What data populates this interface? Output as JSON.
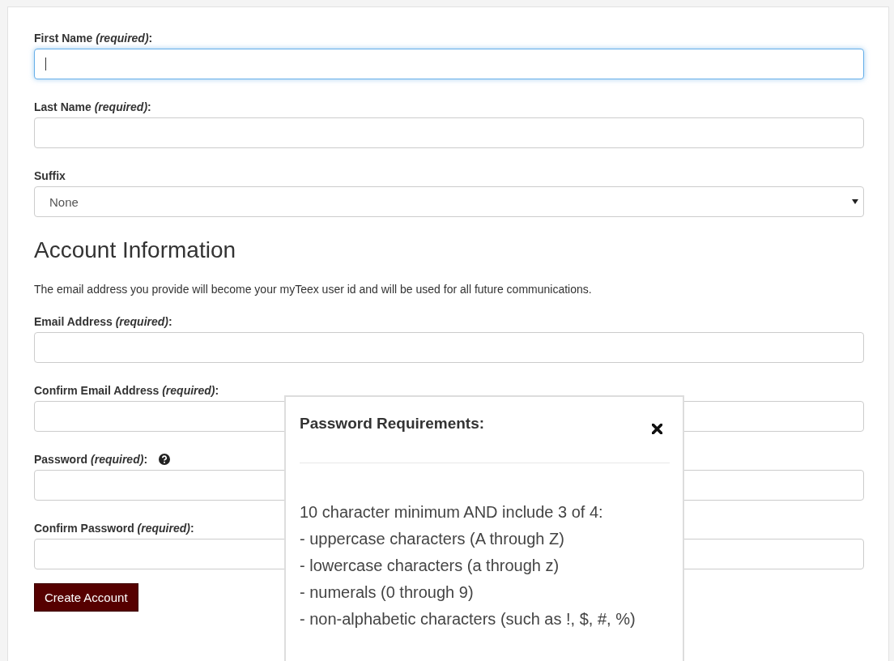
{
  "name_fields": [
    {
      "kind": "text",
      "label": "First Name *(required)*:",
      "focused": true
    },
    {
      "kind": "text",
      "label": "Last Name *(required)*:",
      "focused": false
    },
    {
      "kind": "select",
      "label": "Suffix",
      "value": "None",
      "focused": false
    }
  ],
  "account_section": {
    "title": "Account Information",
    "intro": "The email address you provide will become your myTeex user id and will be used for all future communications.",
    "fields": [
      {
        "kind": "text",
        "label": "Email Address *(required)*:",
        "focused": false
      },
      {
        "kind": "text",
        "label": "Confirm Email Address *(required)*:",
        "focused": false
      },
      {
        "kind": "text",
        "label": "Password *(required)*:",
        "help_icon": true,
        "focused": false
      },
      {
        "kind": "text",
        "label": "Confirm Password *(required)*:",
        "focused": false
      }
    ]
  },
  "submit_button": "Create Account",
  "popup": {
    "title": "Password Requirements:",
    "lines": [
      "10 character minimum AND include 3 of 4:",
      "- uppercase characters (A through Z)",
      "- lowercase characters (a through z)",
      "- numerals (0 through 9)",
      "- non-alphabetic characters (such as !, $, #, %)"
    ]
  }
}
